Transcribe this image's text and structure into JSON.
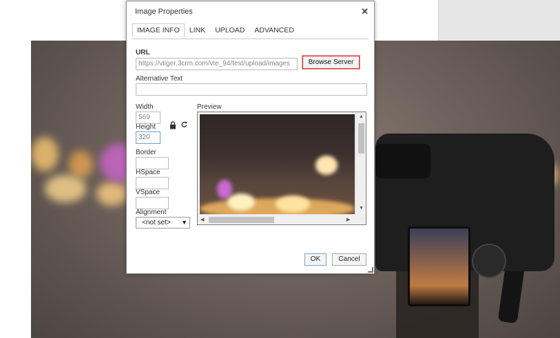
{
  "dialog": {
    "title": "Image Properties",
    "close_glyph": "✕",
    "tabs": [
      "IMAGE INFO",
      "LINK",
      "UPLOAD",
      "ADVANCED"
    ],
    "active_tab": "IMAGE INFO"
  },
  "image_info": {
    "url_label": "URL",
    "url_value": "https://vtiger.3crm.com/vte_94/test/upload/images",
    "browse_label": "Browse Server",
    "alt_label": "Alternative Text",
    "alt_value": "",
    "width_label": "Width",
    "width_value": "569",
    "height_label": "Height",
    "height_value": "320",
    "border_label": "Border",
    "hspace_label": "HSpace",
    "vspace_label": "VSpace",
    "alignment_label": "Alignment",
    "alignment_value": "<not set>",
    "preview_label": "Preview"
  },
  "buttons": {
    "ok": "OK",
    "cancel": "Cancel"
  },
  "icons": {
    "lock": "lock-icon",
    "reset": "refresh-icon",
    "close": "close-icon"
  },
  "colors": {
    "highlight": "#d93b3b",
    "focus_border": "#6b9bd8"
  }
}
